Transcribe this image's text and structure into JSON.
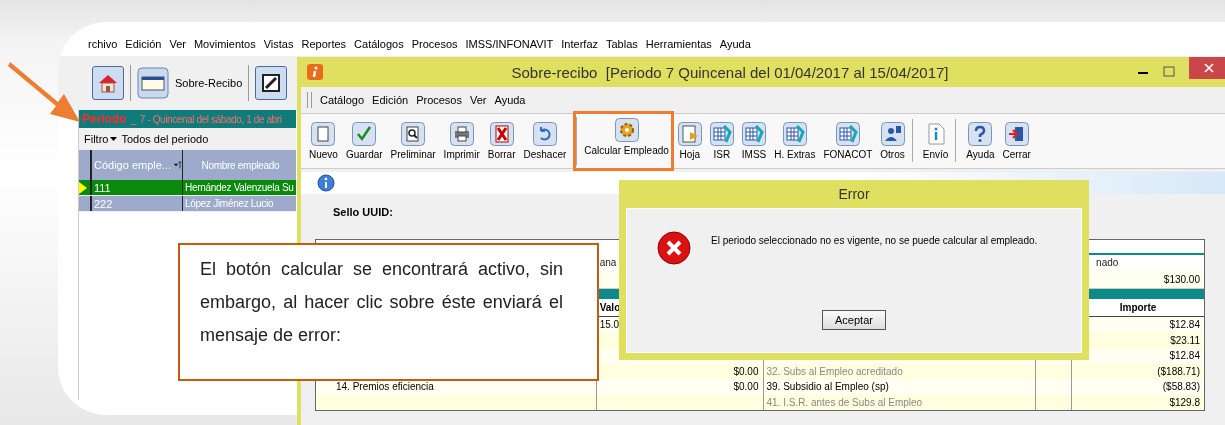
{
  "app": {
    "menu": [
      "rchivo",
      "Edición",
      "Ver",
      "Movimientos",
      "Vistas",
      "Reportes",
      "Catálogos",
      "Procesos",
      "IMSS/INFONAVIT",
      "Interfaz",
      "Tablas",
      "Herramientas",
      "Ayuda"
    ],
    "toolbar": {
      "sobre_recibo": "Sobre-Recibo"
    }
  },
  "periodo": {
    "label": "Periodo",
    "marker": "_",
    "value": "7 - Quincenal del sábado, 1 de abri"
  },
  "filter": {
    "label": "Filtro",
    "value": "Todos del periodo"
  },
  "employees": {
    "columns": [
      "Código emple...",
      "Nombre empleado"
    ],
    "rows": [
      {
        "code": "111",
        "name": "Hernández Valenzuela Su",
        "selected": true
      },
      {
        "code": "222",
        "name": "López Jiménez Lucio",
        "selected": false
      }
    ]
  },
  "window": {
    "title": "Sobre-recibo  [Periodo 7 Quincenal del 01/04/2017 al 15/04/2017]",
    "menu": [
      "Catálogo",
      "Edición",
      "Procesos",
      "Ver",
      "Ayuda"
    ],
    "toolbar": [
      {
        "label": "Nuevo",
        "kind": "page",
        "separator_before": false,
        "highlighted": false
      },
      {
        "label": "Guardar",
        "kind": "check",
        "separator_before": false,
        "highlighted": false
      },
      {
        "label": "Preliminar",
        "kind": "preview",
        "separator_before": false,
        "highlighted": false
      },
      {
        "label": "Imprimir",
        "kind": "printer",
        "separator_before": false,
        "highlighted": false
      },
      {
        "label": "Borrar",
        "kind": "x",
        "separator_before": false,
        "highlighted": false
      },
      {
        "label": "Deshacer",
        "kind": "undo",
        "separator_before": false,
        "highlighted": false
      },
      {
        "label": "Calcular Empleado",
        "kind": "gear",
        "separator_before": true,
        "highlighted": true
      },
      {
        "label": "Hoja",
        "kind": "sheet",
        "separator_before": false,
        "highlighted": false
      },
      {
        "label": "ISR",
        "kind": "report",
        "separator_before": false,
        "highlighted": false
      },
      {
        "label": "IMSS",
        "kind": "report",
        "separator_before": false,
        "highlighted": false
      },
      {
        "label": "H. Extras",
        "kind": "report",
        "separator_before": false,
        "highlighted": false
      },
      {
        "label": "FONACOT",
        "kind": "report",
        "separator_before": false,
        "highlighted": false
      },
      {
        "label": "Otros",
        "kind": "person",
        "separator_before": false,
        "highlighted": false
      },
      {
        "label": "Envío",
        "kind": "docinfo",
        "separator_before": true,
        "highlighted": false
      },
      {
        "label": "Ayuda",
        "kind": "help",
        "separator_before": true,
        "highlighted": false
      },
      {
        "label": "Cerrar",
        "kind": "exit",
        "separator_before": false,
        "highlighted": false
      }
    ],
    "uuid_label": "Sello UUID:",
    "table": {
      "top_left": "ana",
      "top_right": "nado",
      "total": "$130.00",
      "headings": [
        "Valo",
        "Importe"
      ],
      "rows": [
        {
          "value": "15.0",
          "importe": "$12.84"
        },
        {
          "importe": "$23.11"
        },
        {
          "importe": "$12.84"
        },
        {
          "amount": "$0.00",
          "deduction": "32. Subs al Empleo acreditado",
          "dimmed": true,
          "importe": "($188.71)"
        },
        {
          "concept": "14. Premios eficiencia",
          "amount": "$0.00",
          "deduction": "39. Subsidio al Empleo (sp)",
          "dimmed": false,
          "importe": "($58.83)"
        },
        {
          "deduction": "41. I.S.R. antes de Subs al Empleo",
          "dimmed": true,
          "importe": "$129.8"
        }
      ]
    }
  },
  "dialog": {
    "title": "Error",
    "message": "El periodo seleccionado no es vigente, no se puede calcular al empleado.",
    "button": "Aceptar"
  },
  "callout": {
    "text": "El botón calcular se encontrará activo, sin embargo, al hacer clic sobre éste enviará el mensaje de error:"
  }
}
